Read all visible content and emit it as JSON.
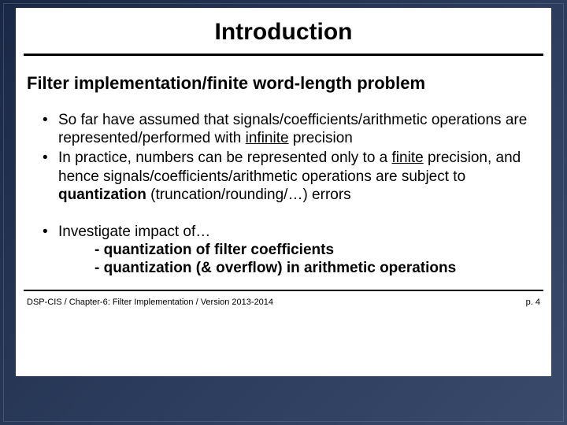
{
  "title": "Introduction",
  "subtitle": "Filter implementation/finite word-length problem",
  "bullet1_a": "So far have assumed that signals/coefficients/arithmetic operations are represented/performed with ",
  "bullet1_b": "infinite",
  "bullet1_c": " precision",
  "bullet2_a": "In practice, numbers can be represented only to a ",
  "bullet2_b": "finite",
  "bullet2_c": " precision, and hence signals/coefficients/arithmetic operations are subject to ",
  "bullet2_d": "quantization",
  "bullet2_e": " (truncation/rounding/…) errors",
  "bullet3": "Investigate impact of…",
  "sub1": "- quantization of filter coefficients",
  "sub2": "- quantization (& overflow) in arithmetic operations",
  "footer_left": "DSP-CIS  /  Chapter-6: Filter Implementation  /  Version 2013-2014",
  "footer_right": "p. 4"
}
